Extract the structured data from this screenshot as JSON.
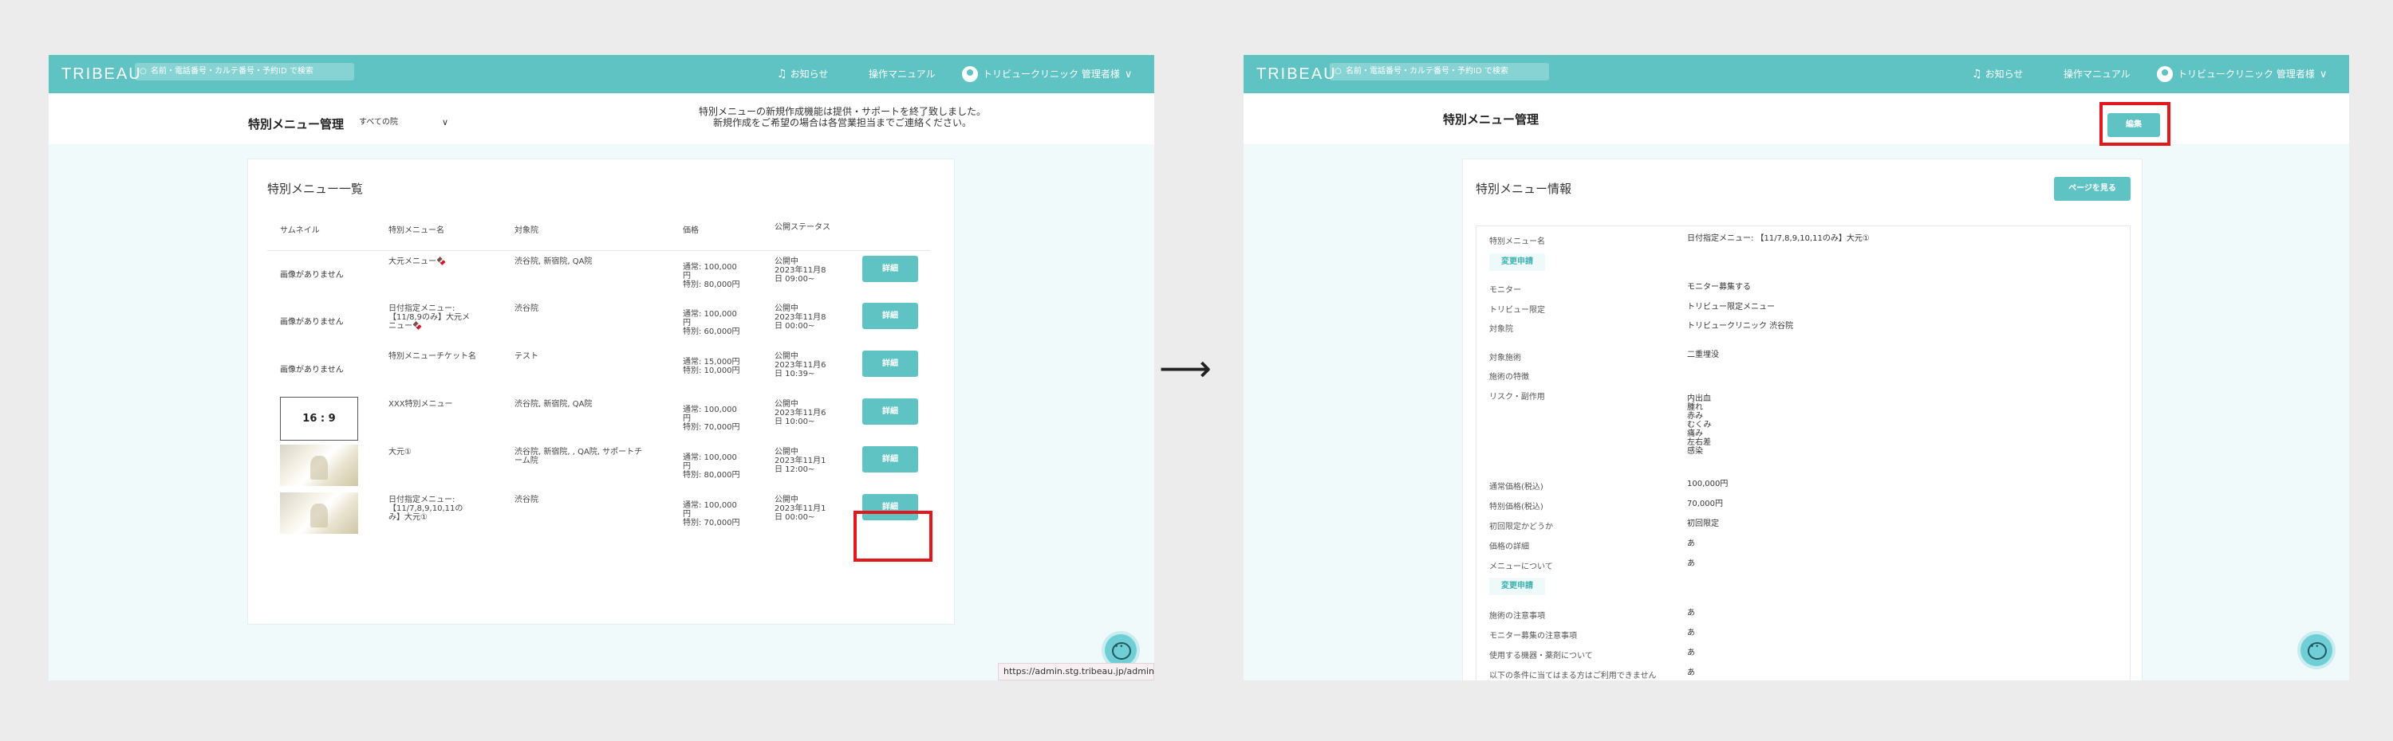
{
  "header": {
    "brand": "TRIBEAU",
    "search_placeholder": "名前・電話番号・カルテ番号・予約ID で検索",
    "notice_label": "お知らせ",
    "manual_label": "操作マニュアル",
    "user_label": "トリビュークリニック 管理者様"
  },
  "left": {
    "page_title": "特別メニュー管理",
    "clinic_select": "すべての院",
    "notice_line1": "特別メニューの新規作成機能は提供・サポートを終了致しました。",
    "notice_line2": "新規作成をご希望の場合は各営業担当までご連絡ください。",
    "card_title": "特別メニュー一覧",
    "columns": [
      "サムネイル",
      "特別メニュー名",
      "対象院",
      "価格",
      "公開ステータス"
    ],
    "detail_label": "詳細",
    "no_image_label": "画像がありません",
    "rows": [
      {
        "thumb": "none",
        "name_l1": "大元メニュー🍫",
        "name_l2": "",
        "name_l3": "",
        "clinic_l1": "渋谷院, 新宿院, QA院",
        "clinic_l2": "",
        "price_l1": "通常: 100,000",
        "price_l2": "円",
        "price_l3": "特別: 80,000円",
        "status_l1": "公開中",
        "status_l2": "2023年11月8",
        "status_l3": "日 09:00~"
      },
      {
        "thumb": "none",
        "name_l1": "日付指定メニュー:",
        "name_l2": "【11/8,9のみ】大元メ",
        "name_l3": "ニュー🍫",
        "clinic_l1": "渋谷院",
        "clinic_l2": "",
        "price_l1": "通常: 100,000",
        "price_l2": "円",
        "price_l3": "特別: 60,000円",
        "status_l1": "公開中",
        "status_l2": "2023年11月8",
        "status_l3": "日 00:00~"
      },
      {
        "thumb": "none",
        "name_l1": "特別メニューチケット名",
        "name_l2": "",
        "name_l3": "",
        "clinic_l1": "テスト",
        "clinic_l2": "",
        "price_l1": "通常: 15,000円",
        "price_l2": "特別: 10,000円",
        "price_l3": "",
        "status_l1": "公開中",
        "status_l2": "2023年11月6",
        "status_l3": "日 10:39~"
      },
      {
        "thumb": "ratio",
        "thumb_text": "16 : 9",
        "name_l1": "XXX特別メニュー",
        "name_l2": "",
        "name_l3": "",
        "clinic_l1": "渋谷院, 新宿院, QA院",
        "clinic_l2": "",
        "price_l1": "通常: 100,000",
        "price_l2": "円",
        "price_l3": "特別: 70,000円",
        "status_l1": "公開中",
        "status_l2": "2023年11月6",
        "status_l3": "日 10:00~"
      },
      {
        "thumb": "image",
        "name_l1": "大元①",
        "name_l2": "",
        "name_l3": "",
        "clinic_l1": "渋谷院, 新宿院, , QA院, サポートチ",
        "clinic_l2": "ーム院",
        "price_l1": "通常: 100,000",
        "price_l2": "円",
        "price_l3": "特別: 80,000円",
        "status_l1": "公開中",
        "status_l2": "2023年11月1",
        "status_l3": "日 12:00~"
      },
      {
        "thumb": "image",
        "name_l1": "日付指定メニュー:",
        "name_l2": "【11/7,8,9,10,11の",
        "name_l3": "み】大元①",
        "clinic_l1": "渋谷院",
        "clinic_l2": "",
        "price_l1": "通常: 100,000",
        "price_l2": "円",
        "price_l3": "特別: 70,000円",
        "status_l1": "公開中",
        "status_l2": "2023年11月1",
        "status_l3": "日 00:00~"
      }
    ],
    "status_url": "https://admin.stg.tribeau.jp/admin"
  },
  "right": {
    "page_title": "特別メニュー管理",
    "edit_label": "編集",
    "card_title": "特別メニュー情報",
    "view_page_label": "ページを見る",
    "change_request_label": "変更申請",
    "fields": {
      "menu_name_label": "特別メニュー名",
      "menu_name_value": "日付指定メニュー: 【11/7,8,9,10,11のみ】大元①",
      "monitor_label": "モニター",
      "monitor_value": "モニター募集する",
      "tribeau_label": "トリビュー限定",
      "tribeau_value": "トリビュー限定メニュー",
      "clinic_label": "対象院",
      "clinic_value": "トリビュークリニック 渋谷院",
      "treatment_label": "対象施術",
      "treatment_value": "二重埋没",
      "feature_label": "施術の特徴",
      "risk_label": "リスク・副作用",
      "risks": [
        "内出血",
        "腫れ",
        "赤み",
        "むくみ",
        "痛み",
        "左右差",
        "感染"
      ],
      "regular_price_label": "通常価格(税込)",
      "regular_price_value": "100,000円",
      "special_price_label": "特別価格(税込)",
      "special_price_value": "70,000円",
      "first_limited_label": "初回限定かどうか",
      "first_limited_value": "初回限定",
      "price_detail_label": "価格の詳細",
      "price_detail_value": "あ",
      "about_menu_label": "メニューについて",
      "about_menu_value": "あ",
      "caution_label": "施術の注意事項",
      "caution_value": "あ",
      "monitor_caution_label": "モニター募集の注意事項",
      "monitor_caution_value": "あ",
      "equipment_label": "使用する機器・薬剤について",
      "equipment_value": "あ",
      "conditions_label": "以下の条件に当てはまる方はご利用できません",
      "conditions_value": "あ"
    }
  },
  "colors": {
    "accent": "#5fc3c3",
    "highlight": "#e0191f",
    "background": "#f1fafa"
  },
  "icons": {
    "search": "search-icon",
    "bell": "bell-icon",
    "chevron": "chevron-down-icon",
    "chat": "chat-icon",
    "arrow": "right-arrow-icon"
  }
}
